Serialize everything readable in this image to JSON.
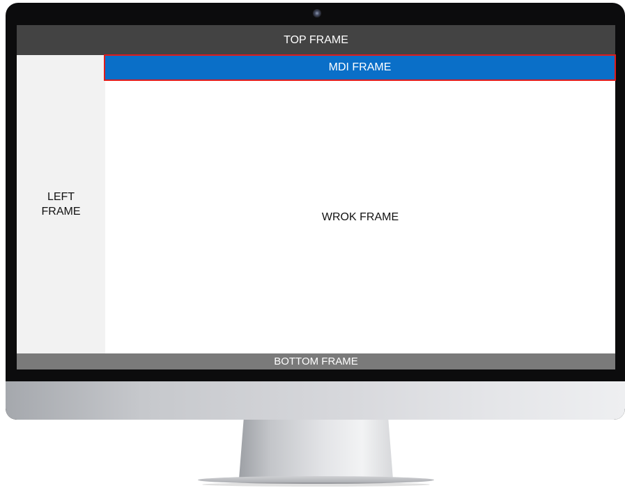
{
  "layout_diagram": {
    "top_frame": "TOP FRAME",
    "mdi_frame": "MDI FRAME",
    "left_frame": "LEFT FRAME",
    "work_frame": "WROK FRAME",
    "bottom_frame": "BOTTOM FRAME"
  },
  "colors": {
    "top_frame_bg": "#434343",
    "left_frame_bg": "#f2f2f2",
    "mdi_frame_bg": "#0a6fc8",
    "mdi_highlight_border": "#e01b1b",
    "bottom_frame_bg": "#7a7a7a",
    "bezel": "#0c0c0d"
  }
}
